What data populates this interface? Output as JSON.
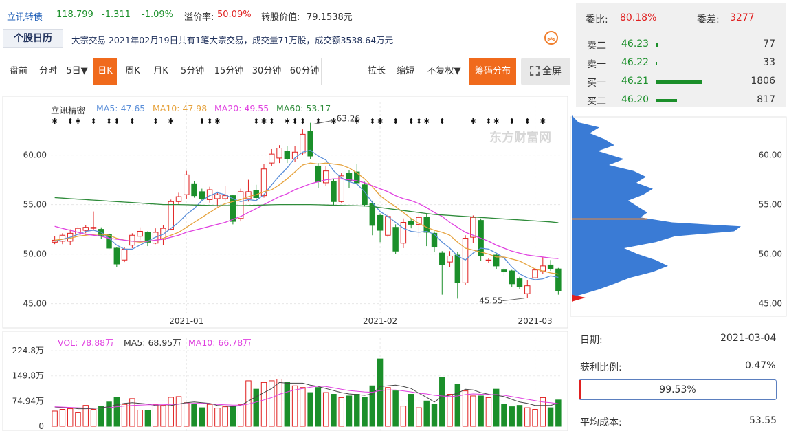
{
  "quote": {
    "name": "立讯转债",
    "price": "118.799",
    "change": "-1.311",
    "change_pct": "-1.09%",
    "premium_label": "溢价率:",
    "premium_value": "50.09%",
    "conv_value_label": "转股价值:",
    "conv_value": "79.1538元"
  },
  "news": {
    "tab": "个股日历",
    "text": "大宗交易 2021年02月19日共有1笔大宗交易，成交量71万股，成交额3538.64万元",
    "expand_icon": "double-chevron-up-icon"
  },
  "period_toolbar": [
    "盘前",
    "分时",
    "5日▼",
    "日K",
    "周K",
    "月K",
    "5分钟",
    "15分钟",
    "30分钟",
    "60分钟"
  ],
  "period_active": "日K",
  "tools_toolbar": [
    "拉长",
    "缩短",
    "不复权▼",
    "筹码分布"
  ],
  "tools_active": "筹码分布",
  "fullscreen_label": "全屏",
  "orderbook": {
    "weibi_label": "委比:",
    "weibi_value": "80.18%",
    "weicha_label": "委差:",
    "weicha_value": "3277",
    "rows": [
      {
        "label": "卖二",
        "price": "46.23",
        "volume": "77",
        "bar": 77
      },
      {
        "label": "卖一",
        "price": "46.22",
        "volume": "33",
        "bar": 33
      },
      {
        "label": "买一",
        "price": "46.21",
        "volume": "1806",
        "bar": 1806
      },
      {
        "label": "买二",
        "price": "46.20",
        "volume": "817",
        "bar": 817
      }
    ]
  },
  "ma_legend": {
    "label": "立讯精密",
    "ma5": "MA5: 47.65",
    "ma10": "MA10: 47.98",
    "ma20": "MA20: 49.55",
    "ma60": "MA60: 53.17"
  },
  "vol_legend": {
    "vol": "VOL: 78.88万",
    "ma5": "MA5: 68.95万",
    "ma10": "MA10: 66.78万"
  },
  "chip_info": {
    "date_label": "日期:",
    "date_value": "2021-03-04",
    "profit_label": "获利比例:",
    "profit_value": "0.47%",
    "profit_fraction": 0.0047,
    "concentration": "99.53%",
    "avg_cost_label": "平均成本:",
    "avg_cost_value": "53.55"
  },
  "colors": {
    "up": "#e02020",
    "down": "#1b8f2a",
    "ma5": "#5b8fd9",
    "ma10": "#e6a23c",
    "ma20": "#e040e0",
    "ma60": "#2e8b3a",
    "chip": "#3a7bd5",
    "accent": "#f06a1c"
  },
  "chart_data": {
    "type": "candlestick",
    "x_ticks": [
      "2021-01",
      "2021-02",
      "2021-03"
    ],
    "y_ticks": [
      "60.00",
      "55.00",
      "50.00",
      "45.00"
    ],
    "ylim": [
      44,
      64
    ],
    "annotations": [
      {
        "label": "63.26",
        "type": "high"
      },
      {
        "label": "45.55",
        "type": "low"
      }
    ],
    "candles": [
      {
        "o": 51.2,
        "c": 51.4,
        "h": 51.8,
        "l": 51.0
      },
      {
        "o": 51.3,
        "c": 51.9,
        "h": 52.1,
        "l": 51.0
      },
      {
        "o": 51.3,
        "c": 52.1,
        "h": 52.5,
        "l": 50.9
      },
      {
        "o": 52.0,
        "c": 52.6,
        "h": 52.8,
        "l": 51.7
      },
      {
        "o": 52.4,
        "c": 52.7,
        "h": 52.9,
        "l": 52.1
      },
      {
        "o": 52.6,
        "c": 52.7,
        "h": 54.3,
        "l": 52.4
      },
      {
        "o": 52.5,
        "c": 51.9,
        "h": 52.7,
        "l": 51.5
      },
      {
        "o": 52.0,
        "c": 50.6,
        "h": 52.1,
        "l": 50.4
      },
      {
        "o": 50.6,
        "c": 49.0,
        "h": 50.7,
        "l": 48.7
      },
      {
        "o": 49.4,
        "c": 50.5,
        "h": 50.7,
        "l": 49.2
      },
      {
        "o": 50.9,
        "c": 51.9,
        "h": 52.1,
        "l": 50.6
      },
      {
        "o": 51.8,
        "c": 52.3,
        "h": 52.7,
        "l": 51.4
      },
      {
        "o": 52.2,
        "c": 51.2,
        "h": 52.3,
        "l": 50.8
      },
      {
        "o": 51.1,
        "c": 52.2,
        "h": 52.6,
        "l": 51.0
      },
      {
        "o": 51.5,
        "c": 52.6,
        "h": 52.9,
        "l": 50.9
      },
      {
        "o": 52.5,
        "c": 55.3,
        "h": 55.5,
        "l": 52.4
      },
      {
        "o": 55.3,
        "c": 55.8,
        "h": 56.2,
        "l": 55.0
      },
      {
        "o": 56.0,
        "c": 58.0,
        "h": 58.4,
        "l": 55.6
      },
      {
        "o": 57.1,
        "c": 55.9,
        "h": 57.4,
        "l": 55.7
      },
      {
        "o": 56.3,
        "c": 55.6,
        "h": 56.6,
        "l": 55.4
      },
      {
        "o": 55.5,
        "c": 56.5,
        "h": 56.8,
        "l": 55.2
      },
      {
        "o": 55.6,
        "c": 56.0,
        "h": 56.3,
        "l": 54.8
      },
      {
        "o": 55.6,
        "c": 55.9,
        "h": 56.9,
        "l": 55.4
      },
      {
        "o": 55.9,
        "c": 53.3,
        "h": 56.0,
        "l": 53.0
      },
      {
        "o": 53.6,
        "c": 56.3,
        "h": 56.6,
        "l": 53.3
      },
      {
        "o": 55.6,
        "c": 56.3,
        "h": 57.5,
        "l": 55.3
      },
      {
        "o": 56.4,
        "c": 55.7,
        "h": 57.0,
        "l": 55.4
      },
      {
        "o": 55.9,
        "c": 58.6,
        "h": 59.1,
        "l": 55.7
      },
      {
        "o": 59.2,
        "c": 60.1,
        "h": 60.6,
        "l": 58.9
      },
      {
        "o": 59.7,
        "c": 60.7,
        "h": 61.0,
        "l": 59.2
      },
      {
        "o": 60.4,
        "c": 59.6,
        "h": 60.9,
        "l": 59.2
      },
      {
        "o": 59.6,
        "c": 60.3,
        "h": 60.9,
        "l": 59.3
      },
      {
        "o": 60.2,
        "c": 62.1,
        "h": 62.6,
        "l": 60.0
      },
      {
        "o": 62.4,
        "c": 59.9,
        "h": 63.26,
        "l": 59.6
      },
      {
        "o": 58.9,
        "c": 57.3,
        "h": 59.2,
        "l": 56.7
      },
      {
        "o": 57.2,
        "c": 58.4,
        "h": 58.9,
        "l": 56.9
      },
      {
        "o": 57.3,
        "c": 55.3,
        "h": 57.6,
        "l": 54.9
      },
      {
        "o": 55.3,
        "c": 57.9,
        "h": 58.2,
        "l": 55.2
      },
      {
        "o": 58.2,
        "c": 57.4,
        "h": 58.5,
        "l": 56.7
      },
      {
        "o": 58.3,
        "c": 57.2,
        "h": 59.1,
        "l": 57.0
      },
      {
        "o": 57.0,
        "c": 55.0,
        "h": 57.3,
        "l": 54.8
      },
      {
        "o": 55.1,
        "c": 52.9,
        "h": 55.4,
        "l": 51.9
      },
      {
        "o": 53.9,
        "c": 52.4,
        "h": 54.1,
        "l": 51.2
      },
      {
        "o": 51.9,
        "c": 53.8,
        "h": 54.0,
        "l": 51.7
      },
      {
        "o": 52.7,
        "c": 50.3,
        "h": 53.0,
        "l": 50.0
      },
      {
        "o": 51.1,
        "c": 53.2,
        "h": 53.6,
        "l": 50.6
      },
      {
        "o": 53.3,
        "c": 53.0,
        "h": 53.6,
        "l": 52.6
      },
      {
        "o": 53.0,
        "c": 53.7,
        "h": 54.2,
        "l": 51.7
      },
      {
        "o": 53.7,
        "c": 52.2,
        "h": 54.0,
        "l": 50.8
      },
      {
        "o": 52.1,
        "c": 50.7,
        "h": 52.3,
        "l": 50.2
      },
      {
        "o": 50.1,
        "c": 48.9,
        "h": 50.3,
        "l": 45.9
      },
      {
        "o": 49.2,
        "c": 49.8,
        "h": 50.3,
        "l": 48.7
      },
      {
        "o": 49.9,
        "c": 47.1,
        "h": 50.2,
        "l": 45.5
      },
      {
        "o": 47.1,
        "c": 51.6,
        "h": 51.9,
        "l": 46.9
      },
      {
        "o": 51.7,
        "c": 53.7,
        "h": 53.9,
        "l": 51.1
      },
      {
        "o": 53.4,
        "c": 49.8,
        "h": 53.6,
        "l": 49.3
      },
      {
        "o": 49.4,
        "c": 49.4,
        "h": 49.6,
        "l": 49.1
      },
      {
        "o": 49.9,
        "c": 48.8,
        "h": 50.1,
        "l": 48.5
      },
      {
        "o": 48.4,
        "c": 48.2,
        "h": 48.6,
        "l": 47.8
      },
      {
        "o": 48.3,
        "c": 47.0,
        "h": 48.4,
        "l": 46.7
      },
      {
        "o": 47.5,
        "c": 46.7,
        "h": 47.7,
        "l": 46.5
      },
      {
        "o": 46.0,
        "c": 46.8,
        "h": 47.4,
        "l": 45.55
      },
      {
        "o": 47.6,
        "c": 48.4,
        "h": 48.7,
        "l": 47.3
      },
      {
        "o": 48.3,
        "c": 48.8,
        "h": 49.7,
        "l": 48.0
      },
      {
        "o": 48.9,
        "c": 48.5,
        "h": 49.4,
        "l": 48.3
      },
      {
        "o": 48.5,
        "c": 46.3,
        "h": 48.6,
        "l": 45.9
      }
    ],
    "series": [
      {
        "name": "MA5",
        "values": [
          51.3,
          51.5,
          51.7,
          52.0,
          52.3,
          52.4,
          52.2,
          51.6,
          50.9,
          50.5,
          50.5,
          50.9,
          51.3,
          51.7,
          52.0,
          52.6,
          53.2,
          54.0,
          54.6,
          55.4,
          55.9,
          56.2,
          56.0,
          55.6,
          55.3,
          55.5,
          55.4,
          56.0,
          57.0,
          57.9,
          58.7,
          59.7,
          60.3,
          60.5,
          59.9,
          59.5,
          58.4,
          57.7,
          57.3,
          57.1,
          56.3,
          55.2,
          54.3,
          53.8,
          53.2,
          52.6,
          52.3,
          52.2,
          52.3,
          52.0,
          51.2,
          50.6,
          49.8,
          49.4,
          50.1,
          50.6,
          50.5,
          50.1,
          49.6,
          48.7,
          48.0,
          47.6,
          47.4,
          47.5,
          47.8,
          47.65
        ]
      },
      {
        "name": "MA10",
        "values": [
          51.4,
          51.5,
          51.6,
          51.8,
          51.9,
          52.0,
          52.0,
          51.9,
          51.6,
          51.4,
          51.3,
          51.2,
          51.3,
          51.4,
          51.6,
          51.9,
          52.2,
          52.7,
          53.2,
          53.7,
          54.2,
          54.7,
          55.1,
          55.3,
          55.5,
          55.8,
          56.0,
          56.3,
          56.5,
          57.0,
          57.6,
          58.3,
          59.0,
          59.2,
          59.1,
          59.2,
          59.1,
          59.0,
          58.7,
          58.2,
          57.6,
          56.8,
          55.9,
          55.3,
          54.8,
          54.2,
          53.6,
          53.1,
          52.7,
          52.4,
          52.2,
          51.9,
          51.2,
          50.6,
          50.4,
          50.2,
          50.0,
          49.7,
          49.7,
          49.5,
          49.3,
          48.9,
          48.5,
          48.3,
          48.1,
          47.98
        ]
      },
      {
        "name": "MA20",
        "values": [
          52.8,
          52.6,
          52.4,
          52.2,
          52.0,
          51.9,
          51.8,
          51.6,
          51.5,
          51.4,
          51.3,
          51.3,
          51.3,
          51.4,
          51.5,
          51.7,
          51.9,
          52.2,
          52.4,
          52.6,
          52.8,
          53.0,
          53.2,
          53.5,
          53.8,
          54.2,
          54.6,
          55.0,
          55.4,
          55.8,
          56.1,
          56.5,
          56.8,
          57.1,
          57.3,
          57.5,
          57.6,
          57.6,
          57.5,
          57.4,
          57.2,
          56.9,
          56.6,
          56.3,
          55.9,
          55.6,
          55.4,
          55.1,
          54.7,
          54.2,
          53.8,
          53.2,
          52.7,
          52.2,
          51.9,
          51.6,
          51.3,
          50.9,
          50.6,
          50.3,
          50.1,
          49.9,
          49.8,
          49.7,
          49.6,
          49.55
        ]
      },
      {
        "name": "MA60",
        "values": [
          55.7,
          55.65,
          55.6,
          55.55,
          55.5,
          55.45,
          55.4,
          55.35,
          55.3,
          55.25,
          55.2,
          55.15,
          55.1,
          55.05,
          55.0,
          55.0,
          55.0,
          54.98,
          54.96,
          54.94,
          54.92,
          54.9,
          54.9,
          54.9,
          54.9,
          54.92,
          54.94,
          54.96,
          54.98,
          55.0,
          55.0,
          55.0,
          55.0,
          55.0,
          54.98,
          54.96,
          54.94,
          54.92,
          54.9,
          54.88,
          54.86,
          54.8,
          54.7,
          54.6,
          54.5,
          54.4,
          54.3,
          54.2,
          54.1,
          54.0,
          53.95,
          53.9,
          53.85,
          53.8,
          53.75,
          53.7,
          53.65,
          53.6,
          53.55,
          53.5,
          53.45,
          53.4,
          53.35,
          53.3,
          53.25,
          53.17
        ]
      }
    ],
    "volume": {
      "y_ticks": [
        "224.8万",
        "149.8万",
        "74.94万",
        "0"
      ],
      "ylim": [
        0,
        224.8
      ],
      "values": [
        45,
        50,
        52,
        40,
        62,
        50,
        60,
        72,
        85,
        65,
        82,
        48,
        48,
        65,
        62,
        86,
        88,
        70,
        65,
        55,
        65,
        54,
        58,
        60,
        65,
        135,
        110,
        130,
        135,
        140,
        130,
        120,
        115,
        100,
        115,
        100,
        95,
        85,
        90,
        95,
        85,
        120,
        200,
        115,
        105,
        60,
        95,
        55,
        75,
        65,
        145,
        95,
        125,
        105,
        90,
        90,
        85,
        110,
        65,
        58,
        62,
        55,
        50,
        85,
        55,
        78
      ],
      "ma5": [
        55,
        56,
        55,
        52,
        52,
        53,
        55,
        58,
        64,
        68,
        70,
        68,
        66,
        62,
        60,
        62,
        66,
        70,
        72,
        70,
        68,
        62,
        60,
        58,
        62,
        75,
        88,
        100,
        112,
        130,
        128,
        128,
        128,
        122,
        118,
        112,
        106,
        100,
        96,
        94,
        92,
        96,
        118,
        120,
        122,
        118,
        112,
        98,
        86,
        72,
        88,
        92,
        98,
        110,
        108,
        100,
        95,
        92,
        88,
        80,
        72,
        68,
        62,
        62,
        62,
        68.95
      ],
      "ma10": [
        58,
        57,
        56,
        55,
        54,
        54,
        54,
        55,
        58,
        60,
        62,
        63,
        64,
        64,
        64,
        65,
        66,
        67,
        68,
        68,
        67,
        65,
        64,
        63,
        63,
        66,
        72,
        78,
        85,
        95,
        102,
        108,
        112,
        116,
        119,
        118,
        114,
        110,
        106,
        104,
        102,
        101,
        106,
        108,
        108,
        105,
        102,
        98,
        96,
        92,
        90,
        88,
        90,
        94,
        96,
        95,
        94,
        94,
        92,
        88,
        84,
        80,
        76,
        72,
        70,
        66.78
      ]
    },
    "chip_distribution": {
      "price_axis": [
        "60.00",
        "55.00",
        "50.00",
        "45.00"
      ],
      "avg_cost": 53.55
    }
  }
}
